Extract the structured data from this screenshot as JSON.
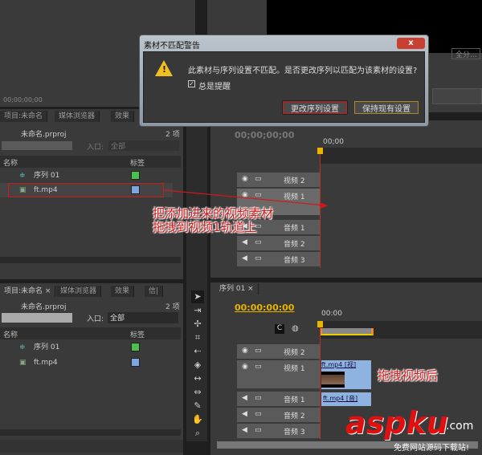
{
  "top": {
    "timecode": "00;00;00;00",
    "fit_button": "全分..."
  },
  "dialog": {
    "title": "素材不匹配警告",
    "close": "x",
    "message": "此素材与序列设置不匹配。是否更改序列以匹配为该素材的设置?",
    "checkbox_label": "总是提醒",
    "checkbox_checked": true,
    "change_button": "更改序列设置",
    "keep_button": "保持现有设置"
  },
  "project_upper": {
    "tabs": [
      "项目:未命名",
      "媒体浏览器",
      "效果"
    ],
    "project_file": "未命名.prproj",
    "count": "2 项",
    "entry_label": "入口:",
    "entry_value": "全部",
    "col_name": "名称",
    "col_label": "标签",
    "items": [
      {
        "name": "序列 01",
        "color": "#4cc04c"
      },
      {
        "name": "ft.mp4",
        "color": "#7da6e0"
      }
    ]
  },
  "annotation1": {
    "line1": "把添加进来的视频素材",
    "line2": "拖拽到视频1轨道上"
  },
  "timeline_upper": {
    "timecode": "00;00;00;00",
    "ruler_start": "00;00",
    "tracks": [
      "视频 2",
      "视频 1",
      "音频 1",
      "音频 2",
      "音频 3"
    ]
  },
  "project_lower": {
    "tabs": [
      "项目:未命名 ×",
      "媒体浏览器",
      "效果",
      "信|"
    ],
    "project_file": "未命名.prproj",
    "count": "2 项",
    "entry_label": "入口:",
    "entry_value": "全部",
    "col_name": "名称",
    "col_label": "标签",
    "items": [
      {
        "name": "序列 01",
        "color": "#4cc04c"
      },
      {
        "name": "ft.mp4",
        "color": "#7da6e0"
      }
    ]
  },
  "timeline_lower": {
    "tab": "序列 01 ×",
    "timecode": "00:00:00:00",
    "ruler_start": "00:00",
    "tracks": [
      "视频 2",
      "视频 1",
      "音频 1",
      "音频 2",
      "音频 3"
    ],
    "video_clip": "ft.mp4 [视]",
    "audio_clip": "ft.mp4 [音]"
  },
  "annotation2": "拖拽视频后",
  "watermark": {
    "brand": "aspku",
    "domain": ".com",
    "tagline": "免费网站源码下载站!"
  },
  "colors": {
    "timecode": "#e8b400",
    "clip": "#8fb3e0",
    "accent_red": "#d01818"
  }
}
